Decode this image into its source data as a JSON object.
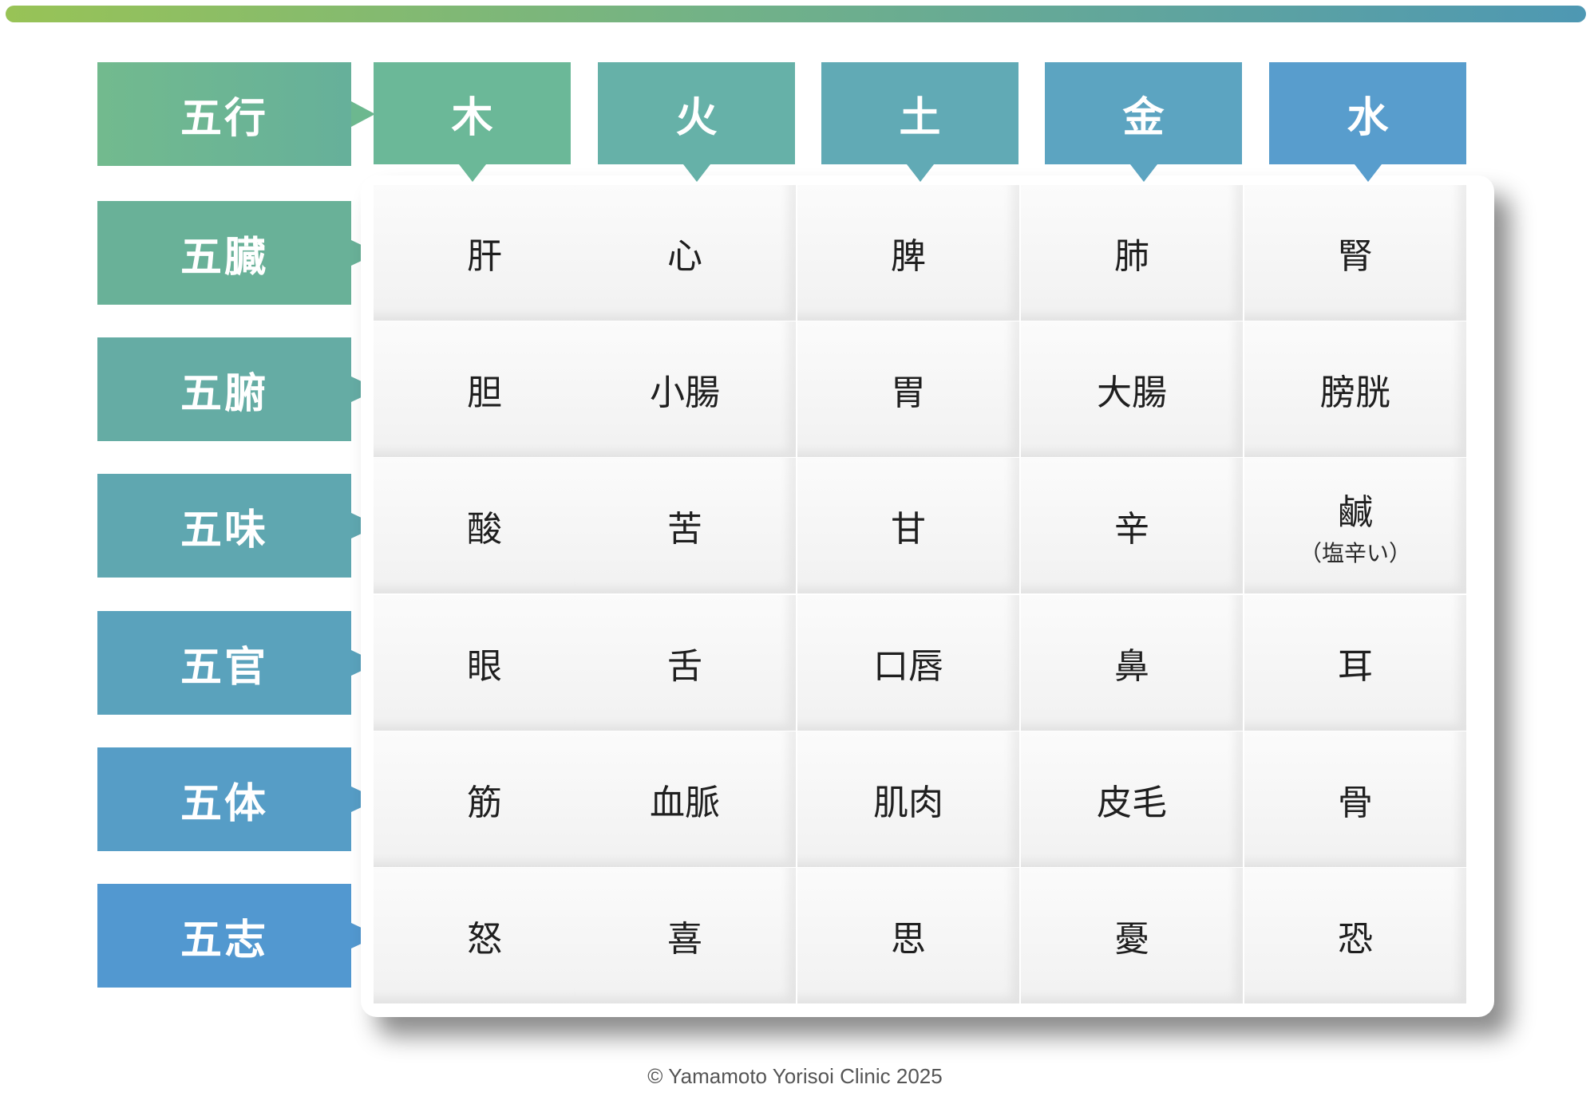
{
  "header_corner": "五行",
  "elements": [
    {
      "label": "木",
      "color": "#6bb898"
    },
    {
      "label": "火",
      "color": "#66b1a8"
    },
    {
      "label": "土",
      "color": "#61aab5"
    },
    {
      "label": "金",
      "color": "#5ca4c1"
    },
    {
      "label": "水",
      "color": "#589dcd"
    }
  ],
  "rows": [
    {
      "label": "五臓",
      "color": "#69b198",
      "cells": [
        {
          "main": "肝"
        },
        {
          "main": "心"
        },
        {
          "main": "脾"
        },
        {
          "main": "肺"
        },
        {
          "main": "腎"
        }
      ]
    },
    {
      "label": "五腑",
      "color": "#65aca4",
      "cells": [
        {
          "main": "胆"
        },
        {
          "main": "小腸"
        },
        {
          "main": "胃"
        },
        {
          "main": "大腸"
        },
        {
          "main": "膀胱"
        }
      ]
    },
    {
      "label": "五味",
      "color": "#5fa7b0",
      "cells": [
        {
          "main": "酸"
        },
        {
          "main": "苦"
        },
        {
          "main": "甘"
        },
        {
          "main": "辛"
        },
        {
          "main": "鹹",
          "sub": "（塩辛い）"
        }
      ]
    },
    {
      "label": "五官",
      "color": "#5aa2bc",
      "cells": [
        {
          "main": "眼"
        },
        {
          "main": "舌"
        },
        {
          "main": "口唇"
        },
        {
          "main": "鼻"
        },
        {
          "main": "耳"
        }
      ]
    },
    {
      "label": "五体",
      "color": "#569dc6",
      "cells": [
        {
          "main": "筋"
        },
        {
          "main": "血脈"
        },
        {
          "main": "肌肉"
        },
        {
          "main": "皮毛"
        },
        {
          "main": "骨"
        }
      ]
    },
    {
      "label": "五志",
      "color": "#5298d0",
      "cells": [
        {
          "main": "怒"
        },
        {
          "main": "喜"
        },
        {
          "main": "思"
        },
        {
          "main": "憂"
        },
        {
          "main": "恐"
        }
      ]
    }
  ],
  "copyright": "© Yamamoto Yorisoi Clinic 2025"
}
